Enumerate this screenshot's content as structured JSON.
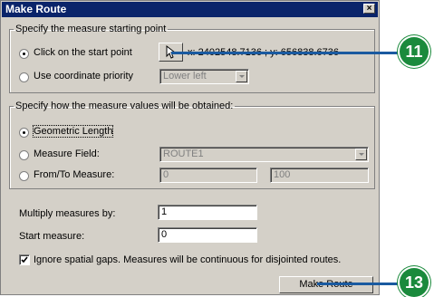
{
  "window": {
    "title": "Make Route",
    "close_glyph": "×"
  },
  "start_group": {
    "legend": "Specify the measure starting point",
    "click_start_label": "Click on the start point",
    "coordinates": "x: 2402548.7136 ; y: 656838.6736",
    "coord_priority_label": "Use coordinate priority",
    "coord_priority_value": "Lower left"
  },
  "measure_group": {
    "legend": "Specify how the measure values will be obtained:",
    "geometric_label": "Geometric Length",
    "measure_field_label": "Measure Field:",
    "measure_field_value": "ROUTE1",
    "fromto_label": "From/To Measure:",
    "from_value": "0",
    "to_value": "100"
  },
  "multiply": {
    "label": "Multiply measures by:",
    "value": "1"
  },
  "start_measure": {
    "label": "Start measure:",
    "value": "0"
  },
  "ignore_gaps": {
    "label": "Ignore spatial gaps. Measures will be continuous for disjointed routes.",
    "checked": true
  },
  "make_route_button": "Make Route",
  "callouts": {
    "first": "11",
    "second": "13"
  },
  "colors": {
    "callout": "#1a8a3c",
    "leader_line": "#1a5aa0",
    "titlebar": "#0a246a"
  }
}
